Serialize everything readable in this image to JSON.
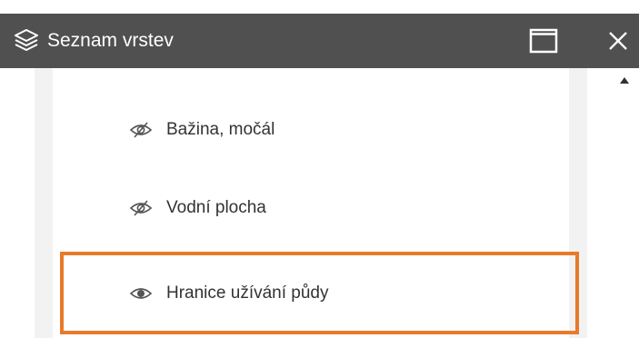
{
  "panel": {
    "title": "Seznam vrstev",
    "header_color": "#505050",
    "icons": {
      "layers": "layers-icon",
      "maximize": "maximize-icon",
      "close": "close-icon"
    }
  },
  "layers": [
    {
      "label": "Bažina, močál",
      "visible": false,
      "icon": "eye-slash-icon"
    },
    {
      "label": "Vodní plocha",
      "visible": false,
      "icon": "eye-slash-icon"
    },
    {
      "label": "Hranice užívání půdy",
      "visible": true,
      "icon": "eye-icon",
      "highlighted": true
    }
  ],
  "highlight_color": "#e87a2a"
}
